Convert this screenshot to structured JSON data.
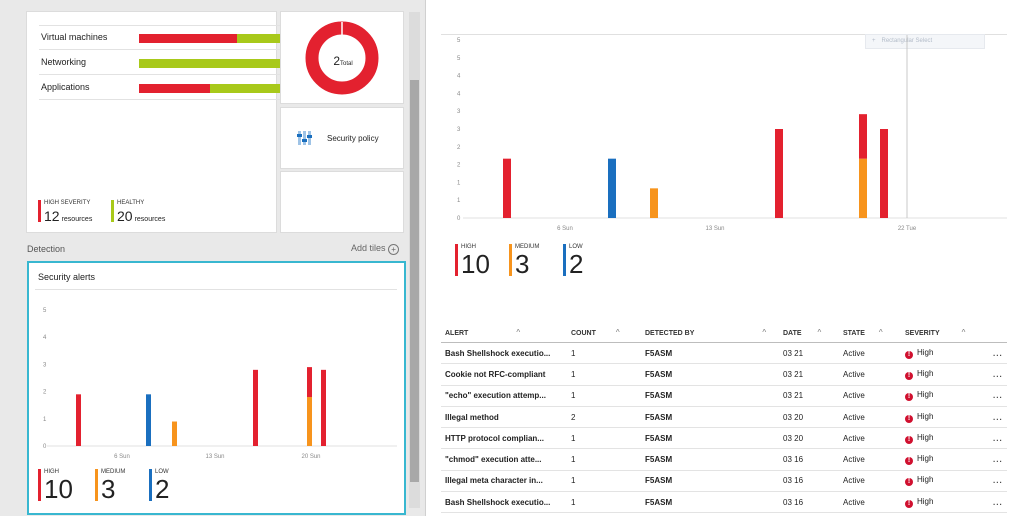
{
  "resources": {
    "rows": [
      {
        "label": "Virtual machines",
        "red_fraction": 0.69
      },
      {
        "label": "Networking",
        "red_fraction": 0.0
      },
      {
        "label": "Applications",
        "red_fraction": 0.5
      }
    ],
    "high_severity": {
      "caption": "HIGH SEVERITY",
      "count": "12",
      "unit": "resources"
    },
    "healthy": {
      "caption": "HEALTHY",
      "count": "20",
      "unit": "resources"
    }
  },
  "donut": {
    "value": "2",
    "label": "Total"
  },
  "security_policy": {
    "label": "Security policy"
  },
  "detection": {
    "section_label": "Detection",
    "add_tiles_label": "Add tiles",
    "tile_title": "Security alerts"
  },
  "legend": {
    "high": {
      "caption": "HIGH",
      "count": "10"
    },
    "medium": {
      "caption": "MEDIUM",
      "count": "3"
    },
    "low": {
      "caption": "LOW",
      "count": "2"
    }
  },
  "colors": {
    "high": "#e3212f",
    "medium": "#f7941d",
    "low": "#1a6fbf",
    "healthy": "#a8c91a",
    "tile_border": "#38b7d0"
  },
  "rectangular_select": {
    "label": "Rectangular Select"
  },
  "chart_data": [
    {
      "type": "bar",
      "title": "Security alerts",
      "y_ticks": [
        "5",
        "4",
        "3",
        "2",
        "1",
        "0"
      ],
      "x_ticks": [
        "6 Sun",
        "13 Sun",
        "20 Sun"
      ],
      "ylim": [
        0,
        5
      ],
      "series": [
        {
          "name": "HIGH",
          "values": [
            1.9,
            0,
            0,
            2.8,
            1.1,
            2.8
          ]
        },
        {
          "name": "MEDIUM",
          "values": [
            0,
            0,
            0.9,
            0,
            1.8,
            0
          ]
        },
        {
          "name": "LOW",
          "values": [
            0,
            1.9,
            0,
            0,
            0,
            0
          ]
        }
      ]
    },
    {
      "type": "bar",
      "y_ticks": [
        "5",
        "5",
        "4",
        "4",
        "3",
        "3",
        "2",
        "2",
        "1",
        "1",
        "0"
      ],
      "x_ticks": [
        "6 Sun",
        "13 Sun",
        "22 Tue"
      ],
      "ylim": [
        0,
        6
      ],
      "series": [
        {
          "name": "HIGH",
          "values": [
            2.0,
            0,
            0,
            3.0,
            1.5,
            3.0
          ]
        },
        {
          "name": "MEDIUM",
          "values": [
            0,
            0,
            1.0,
            0,
            2.0,
            0
          ]
        },
        {
          "name": "LOW",
          "values": [
            0,
            2.0,
            0,
            0,
            0,
            0
          ]
        }
      ]
    }
  ],
  "table": {
    "headers": [
      "ALERT",
      "COUNT",
      "DETECTED BY",
      "DATE",
      "STATE",
      "SEVERITY"
    ],
    "more_label": "...",
    "rows": [
      {
        "alert": "Bash Shellshock executio...",
        "count": "1",
        "detected_by": "F5ASM",
        "date": "03 21",
        "state": "Active",
        "severity": "High"
      },
      {
        "alert": "Cookie not RFC-compliant",
        "count": "1",
        "detected_by": "F5ASM",
        "date": "03 21",
        "state": "Active",
        "severity": "High"
      },
      {
        "alert": "\"echo\" execution attemp...",
        "count": "1",
        "detected_by": "F5ASM",
        "date": "03 21",
        "state": "Active",
        "severity": "High"
      },
      {
        "alert": "Illegal method",
        "count": "2",
        "detected_by": "F5ASM",
        "date": "03 20",
        "state": "Active",
        "severity": "High"
      },
      {
        "alert": "HTTP protocol complian...",
        "count": "1",
        "detected_by": "F5ASM",
        "date": "03 20",
        "state": "Active",
        "severity": "High"
      },
      {
        "alert": "\"chmod\" execution atte...",
        "count": "1",
        "detected_by": "F5ASM",
        "date": "03 16",
        "state": "Active",
        "severity": "High"
      },
      {
        "alert": "Illegal meta character in...",
        "count": "1",
        "detected_by": "F5ASM",
        "date": "03 16",
        "state": "Active",
        "severity": "High"
      },
      {
        "alert": "Bash Shellshock executio...",
        "count": "1",
        "detected_by": "F5ASM",
        "date": "03 16",
        "state": "Active",
        "severity": "High"
      }
    ]
  }
}
